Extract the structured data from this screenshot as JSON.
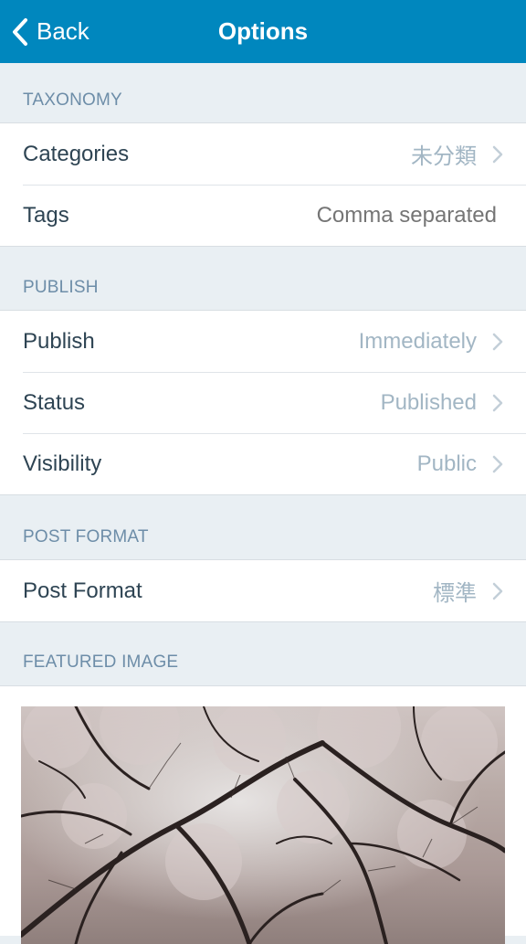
{
  "navbar": {
    "back_label": "Back",
    "title": "Options",
    "color": "#0087be"
  },
  "sections": {
    "taxonomy": {
      "header": "TAXONOMY",
      "rows": [
        {
          "label": "Categories",
          "value": "未分類"
        },
        {
          "label": "Tags",
          "value": "Comma separated"
        }
      ]
    },
    "publish": {
      "header": "PUBLISH",
      "rows": [
        {
          "label": "Publish",
          "value": "Immediately"
        },
        {
          "label": "Status",
          "value": "Published"
        },
        {
          "label": "Visibility",
          "value": "Public"
        }
      ]
    },
    "post_format": {
      "header": "POST FORMAT",
      "rows": [
        {
          "label": "Post Format",
          "value": "標準"
        }
      ]
    },
    "featured_image": {
      "header": "FEATURED IMAGE"
    }
  },
  "icons": {
    "back": "chevron-left-icon",
    "disclosure": "chevron-right-icon"
  }
}
